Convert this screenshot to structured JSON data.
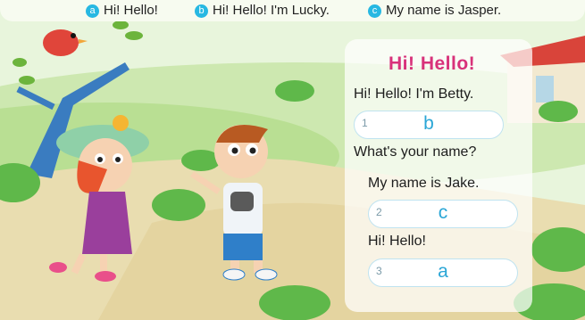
{
  "options": [
    {
      "letter": "a",
      "text": "Hi! Hello!"
    },
    {
      "letter": "b",
      "text": "Hi! Hello! I'm Lucky."
    },
    {
      "letter": "c",
      "text": "My name is Jasper."
    }
  ],
  "dialogue": {
    "title": "Hi! Hello!",
    "lines": [
      "Hi! Hello! I'm Betty.",
      "What's your name?",
      "My name is Jake.",
      "Hi! Hello!"
    ],
    "answers": [
      {
        "number": "1",
        "answer": "b"
      },
      {
        "number": "2",
        "answer": "c"
      },
      {
        "number": "3",
        "answer": "a"
      }
    ]
  },
  "colors": {
    "title": "#d8327a",
    "option_badge": "#27b8e2",
    "answer_text": "#2aa6d6"
  }
}
